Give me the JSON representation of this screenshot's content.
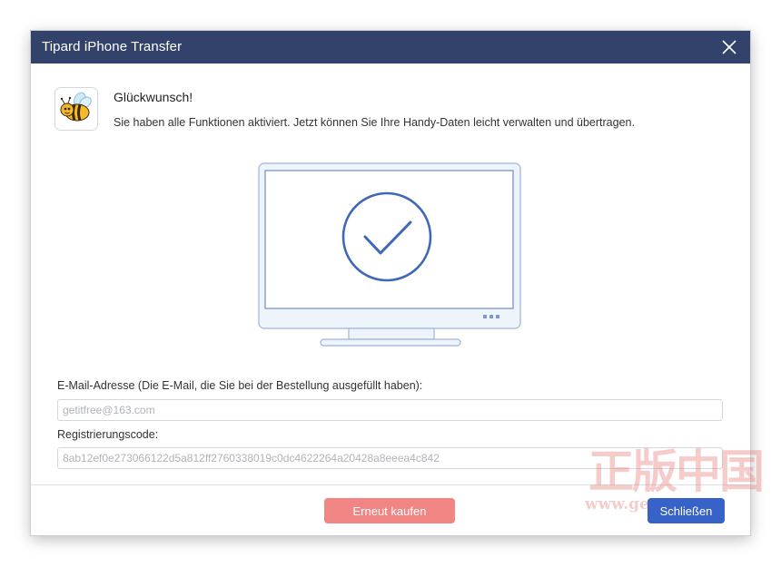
{
  "window": {
    "title": "Tipard iPhone Transfer"
  },
  "header": {
    "headline": "Glückwunsch!",
    "message": "Sie haben alle Funktionen aktiviert. Jetzt können Sie Ihre Handy-Daten leicht verwalten und übertragen."
  },
  "form": {
    "email_label": "E-Mail-Adresse (Die E-Mail, die Sie bei der Bestellung ausgefüllt haben):",
    "email_value": "getitfree@163.com",
    "code_label": "Registrierungscode:",
    "code_value": "8ab12ef0e273066122d5a812ff2760338019c0dc4622264a20428a8eeea4c842"
  },
  "buttons": {
    "buy_again": "Erneut kaufen",
    "close": "Schließen"
  },
  "watermark": {
    "text": "正版中国",
    "url": "www.ge"
  },
  "colors": {
    "titlebar": "#33426a",
    "accent": "#3762c7",
    "buy_button": "#f08583",
    "illustration": "#3f68b7"
  },
  "icons": {
    "app": "bee-icon",
    "close": "close-icon",
    "success": "checkmark-icon"
  }
}
